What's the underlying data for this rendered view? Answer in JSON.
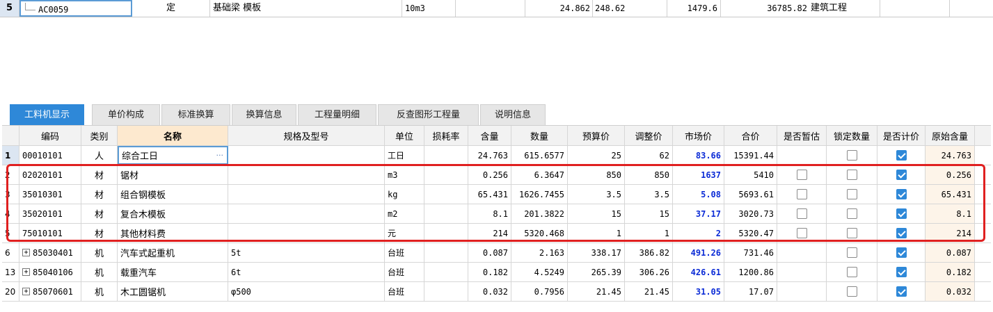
{
  "top_row": {
    "rownum": "5",
    "code": "AC0059",
    "type": "定",
    "name": "基础梁 模板",
    "unit": "10m3",
    "qty1": "24.862",
    "qty2": "248.62",
    "price": "1479.6",
    "total": "36785.82",
    "category": "建筑工程"
  },
  "tabs": [
    {
      "label": "工料机显示",
      "active": true
    },
    {
      "label": "单价构成"
    },
    {
      "label": "标准换算"
    },
    {
      "label": "换算信息"
    },
    {
      "label": "工程量明细"
    },
    {
      "label": "反查图形工程量"
    },
    {
      "label": "说明信息"
    }
  ],
  "columns": [
    "编码",
    "类别",
    "名称",
    "规格及型号",
    "单位",
    "损耗率",
    "含量",
    "数量",
    "预算价",
    "调整价",
    "市场价",
    "合价",
    "是否暂估",
    "锁定数量",
    "是否计价",
    "原始含量"
  ],
  "rows": [
    {
      "rn": "1",
      "code": "00010101",
      "type": "人",
      "name": "综合工日",
      "spec": "",
      "unit": "工日",
      "loss": "",
      "content": "24.763",
      "qty": "615.6577",
      "budget": "25",
      "adj": "62",
      "market": "83.66",
      "total": "15391.44",
      "est": null,
      "lock": false,
      "priced": true,
      "orig": "24.763",
      "expand": false
    },
    {
      "rn": "2",
      "code": "02020101",
      "type": "材",
      "name": "锯材",
      "spec": "",
      "unit": "m3",
      "loss": "",
      "content": "0.256",
      "qty": "6.3647",
      "budget": "850",
      "adj": "850",
      "market": "1637",
      "total": "5410",
      "est": false,
      "lock": false,
      "priced": true,
      "orig": "0.256",
      "expand": false
    },
    {
      "rn": "3",
      "code": "35010301",
      "type": "材",
      "name": "组合钢模板",
      "spec": "",
      "unit": "kg",
      "loss": "",
      "content": "65.431",
      "qty": "1626.7455",
      "budget": "3.5",
      "adj": "3.5",
      "market": "5.08",
      "total": "5693.61",
      "est": false,
      "lock": false,
      "priced": true,
      "orig": "65.431",
      "expand": false
    },
    {
      "rn": "4",
      "code": "35020101",
      "type": "材",
      "name": "复合木模板",
      "spec": "",
      "unit": "m2",
      "loss": "",
      "content": "8.1",
      "qty": "201.3822",
      "budget": "15",
      "adj": "15",
      "market": "37.17",
      "total": "3020.73",
      "est": false,
      "lock": false,
      "priced": true,
      "orig": "8.1",
      "expand": false
    },
    {
      "rn": "5",
      "code": "75010101",
      "type": "材",
      "name": "其他材料费",
      "spec": "",
      "unit": "元",
      "loss": "",
      "content": "214",
      "qty": "5320.468",
      "budget": "1",
      "adj": "1",
      "market": "2",
      "total": "5320.47",
      "est": false,
      "lock": false,
      "priced": true,
      "orig": "214",
      "expand": false
    },
    {
      "rn": "6",
      "code": "85030401",
      "type": "机",
      "name": "汽车式起重机",
      "spec": "5t",
      "unit": "台班",
      "loss": "",
      "content": "0.087",
      "qty": "2.163",
      "budget": "338.17",
      "adj": "386.82",
      "market": "491.26",
      "total": "731.46",
      "est": null,
      "lock": false,
      "priced": true,
      "orig": "0.087",
      "expand": true
    },
    {
      "rn": "13",
      "code": "85040106",
      "type": "机",
      "name": "载重汽车",
      "spec": "6t",
      "unit": "台班",
      "loss": "",
      "content": "0.182",
      "qty": "4.5249",
      "budget": "265.39",
      "adj": "306.26",
      "market": "426.61",
      "total": "1200.86",
      "est": null,
      "lock": false,
      "priced": true,
      "orig": "0.182",
      "expand": true
    },
    {
      "rn": "20",
      "code": "85070601",
      "type": "机",
      "name": "木工圆锯机",
      "spec": "φ500",
      "unit": "台班",
      "loss": "",
      "content": "0.032",
      "qty": "0.7956",
      "budget": "21.45",
      "adj": "21.45",
      "market": "31.05",
      "total": "17.07",
      "est": null,
      "lock": false,
      "priced": true,
      "orig": "0.032",
      "expand": true
    }
  ],
  "icons": {
    "ellipsis": "more-icon",
    "expand": "expand-plus-icon",
    "check": "checkbox-checked-icon"
  },
  "colors": {
    "tab_active": "#2e88d8",
    "market_price": "#0b2bd6",
    "highlight": "#e02020"
  }
}
